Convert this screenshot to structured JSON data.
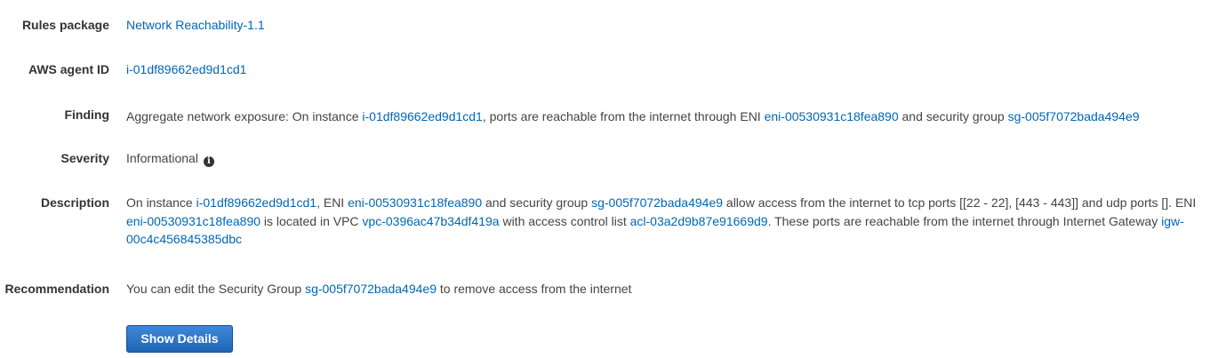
{
  "fields": {
    "rules_package": {
      "label": "Rules package",
      "value": "Network Reachability-1.1"
    },
    "agent_id": {
      "label": "AWS agent ID",
      "value": "i-01df89662ed9d1cd1"
    },
    "finding": {
      "label": "Finding",
      "text1": "Aggregate network exposure: On instance ",
      "instance": "i-01df89662ed9d1cd1",
      "text2": ", ports are reachable from the internet through ENI ",
      "eni": "eni-00530931c18fea890",
      "text3": " and security group ",
      "sg": "sg-005f7072bada494e9"
    },
    "severity": {
      "label": "Severity",
      "value": "Informational",
      "icon": "info-circle-icon"
    },
    "description": {
      "label": "Description",
      "text1": "On instance ",
      "instance": "i-01df89662ed9d1cd1",
      "text2": ", ENI ",
      "eni": "eni-00530931c18fea890",
      "text3": " and security group ",
      "sg": "sg-005f7072bada494e9",
      "text4": " allow access from the internet to tcp ports [[22 - 22], [443 - 443]] and udp ports []. ENI ",
      "eni2": "eni-00530931c18fea890",
      "text5": " is located in VPC ",
      "vpc": "vpc-0396ac47b34df419a",
      "text6": " with access control list ",
      "acl": "acl-03a2d9b87e91669d9",
      "text7": ". These ports are reachable from the internet through Internet Gateway ",
      "igw": "igw-00c4c456845385dbc"
    },
    "recommendation": {
      "label": "Recommendation",
      "text1": "You can edit the Security Group ",
      "sg": "sg-005f7072bada494e9",
      "text2": " to remove access from the internet"
    }
  },
  "actions": {
    "show_details_label": "Show Details"
  },
  "colors": {
    "link": "#0066b5",
    "button": "#2a72c4"
  }
}
